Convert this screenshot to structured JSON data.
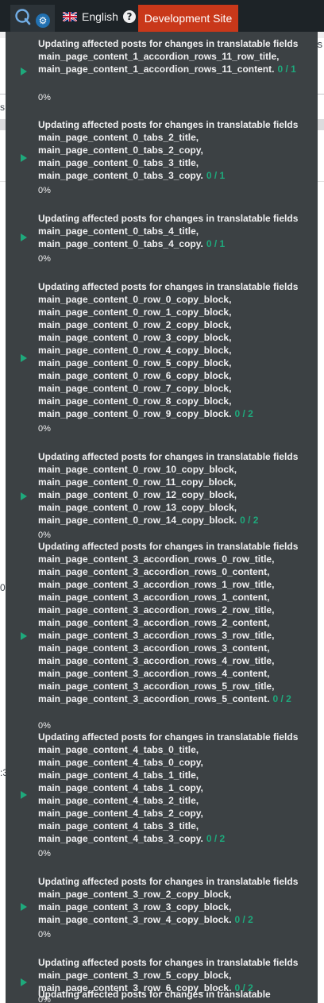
{
  "admin_bar": {
    "language_label": "English",
    "help_symbol": "?",
    "dev_site_label": "Development Site",
    "colors": {
      "bar": "#1d2327",
      "dev_site": "#c9381a",
      "gear": "#2271b1"
    },
    "icons": [
      "translation-q-icon",
      "gear-icon",
      "uk-flag-icon",
      "help-icon"
    ]
  },
  "background": {
    "left_fragments": [
      "s",
      "0",
      ":3"
    ],
    "right_fragment": "s"
  },
  "dropdown": {
    "accent_color": "#1ea97c",
    "items": [
      {
        "message": "Updating affected posts for changes in translatable fields main_page_content_1_accordion_rows_11_row_title, main_page_content_1_accordion_rows_11_content.",
        "count": "0 / 1",
        "percent": "0%"
      },
      {
        "message": "Updating affected posts for changes in translatable fields main_page_content_0_tabs_2_title, main_page_content_0_tabs_2_copy, main_page_content_0_tabs_3_title, main_page_content_0_tabs_3_copy.",
        "count": "0 / 1",
        "percent": "0%"
      },
      {
        "message": "Updating affected posts for changes in translatable fields main_page_content_0_tabs_4_title, main_page_content_0_tabs_4_copy.",
        "count": "0 / 1",
        "percent": "0%"
      },
      {
        "message": "Updating affected posts for changes in translatable fields main_page_content_0_row_0_copy_block, main_page_content_0_row_1_copy_block, main_page_content_0_row_2_copy_block, main_page_content_0_row_3_copy_block, main_page_content_0_row_4_copy_block, main_page_content_0_row_5_copy_block, main_page_content_0_row_6_copy_block, main_page_content_0_row_7_copy_block, main_page_content_0_row_8_copy_block, main_page_content_0_row_9_copy_block.",
        "count": "0 / 2",
        "percent": "0%"
      },
      {
        "message": "Updating affected posts for changes in translatable fields main_page_content_0_row_10_copy_block, main_page_content_0_row_11_copy_block, main_page_content_0_row_12_copy_block, main_page_content_0_row_13_copy_block, main_page_content_0_row_14_copy_block.",
        "count": "0 / 2",
        "percent": "0%"
      },
      {
        "message": "Updating affected posts for changes in translatable fields main_page_content_3_accordion_rows_0_row_title, main_page_content_3_accordion_rows_0_content, main_page_content_3_accordion_rows_1_row_title, main_page_content_3_accordion_rows_1_content, main_page_content_3_accordion_rows_2_row_title, main_page_content_3_accordion_rows_2_content, main_page_content_3_accordion_rows_3_row_title, main_page_content_3_accordion_rows_3_content, main_page_content_3_accordion_rows_4_row_title, main_page_content_3_accordion_rows_4_content, main_page_content_3_accordion_rows_5_row_title, main_page_content_3_accordion_rows_5_content.",
        "count": "0 / 2",
        "percent": "0%"
      },
      {
        "message": "Updating affected posts for changes in translatable fields main_page_content_4_tabs_0_title, main_page_content_4_tabs_0_copy, main_page_content_4_tabs_1_title, main_page_content_4_tabs_1_copy, main_page_content_4_tabs_2_title, main_page_content_4_tabs_2_copy, main_page_content_4_tabs_3_title, main_page_content_4_tabs_3_copy.",
        "count": "0 / 2",
        "percent": "0%"
      },
      {
        "message": "Updating affected posts for changes in translatable fields main_page_content_3_row_2_copy_block, main_page_content_3_row_3_copy_block, main_page_content_3_row_4_copy_block.",
        "count": "0 / 2",
        "percent": "0%"
      },
      {
        "message": "Updating affected posts for changes in translatable fields main_page_content_3_row_5_copy_block, main_page_content_3_row_6_copy_block.",
        "count": "0 / 2",
        "percent": "0%"
      },
      {
        "message": "Updating affected posts for changes in translatable",
        "count": "",
        "percent": ""
      }
    ]
  }
}
